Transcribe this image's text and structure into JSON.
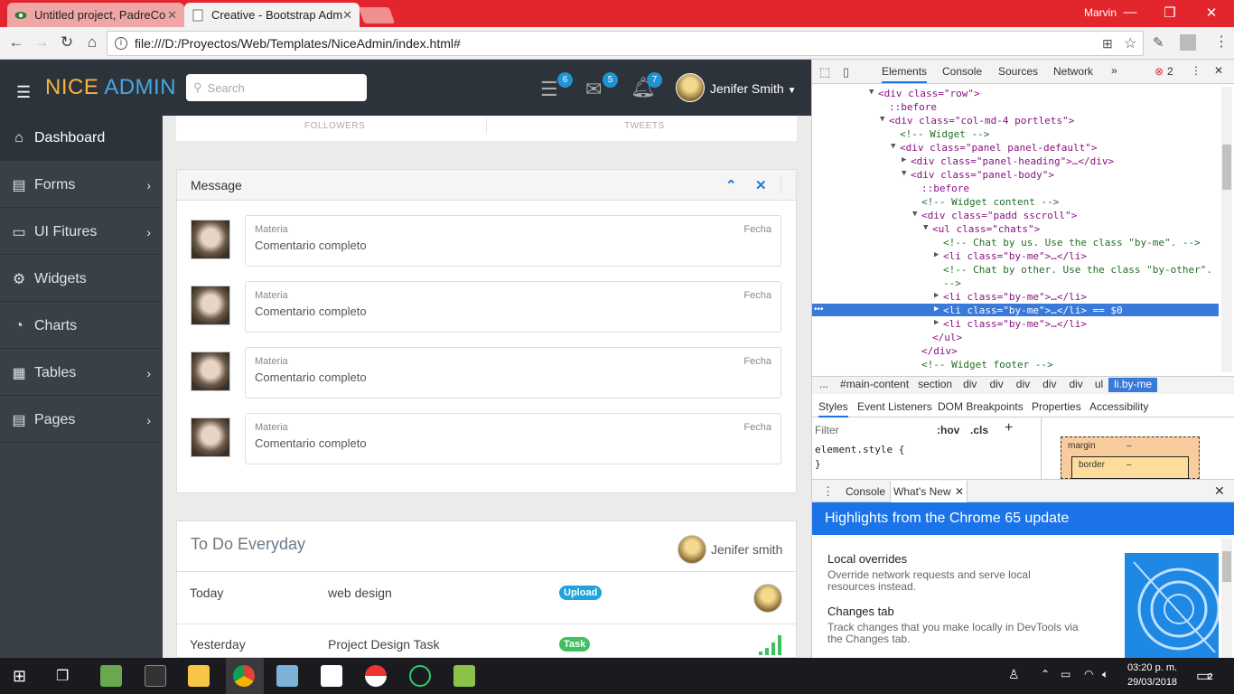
{
  "browser": {
    "tabs": [
      {
        "title": "Untitled project, PadreCo"
      },
      {
        "title": "Creative - Bootstrap Adm"
      }
    ],
    "user": "Marvin",
    "url": "file:///D:/Proyectos/Web/Templates/NiceAdmin/index.html#"
  },
  "app": {
    "logo_part1": "NICE ",
    "logo_part2": "ADMIN",
    "search_placeholder": "Search",
    "badges": {
      "tasks": "6",
      "mail": "5",
      "notifications": "7"
    },
    "user_name": "Jenifer Smith"
  },
  "sidebar": {
    "items": [
      {
        "label": "Dashboard",
        "icon": "home-icon"
      },
      {
        "label": "Forms",
        "icon": "document-icon"
      },
      {
        "label": "UI Fitures",
        "icon": "monitor-icon"
      },
      {
        "label": "Widgets",
        "icon": "cog-icon"
      },
      {
        "label": "Charts",
        "icon": "pie-chart-icon"
      },
      {
        "label": "Tables",
        "icon": "table-icon"
      },
      {
        "label": "Pages",
        "icon": "pages-icon"
      }
    ]
  },
  "stats": {
    "followers": "FOLLOWERS",
    "tweets": "TWEETS"
  },
  "message_panel": {
    "title": "Message",
    "chats": [
      {
        "subject": "Materia",
        "date": "Fecha",
        "body": "Comentario completo"
      },
      {
        "subject": "Materia",
        "date": "Fecha",
        "body": "Comentario completo"
      },
      {
        "subject": "Materia",
        "date": "Fecha",
        "body": "Comentario completo"
      },
      {
        "subject": "Materia",
        "date": "Fecha",
        "body": "Comentario completo"
      }
    ]
  },
  "todo_panel": {
    "title": "To Do Everyday",
    "user": "Jenifer smith",
    "rows": [
      {
        "day": "Today",
        "task": "web design",
        "tag": "Upload",
        "tag_color": "#1fa3dc"
      },
      {
        "day": "Yesterday",
        "task": "Project Design Task",
        "tag": "Task",
        "tag_color": "#3cc15d"
      }
    ]
  },
  "devtools": {
    "tabs": [
      "Elements",
      "Console",
      "Sources",
      "Network"
    ],
    "error_count": "2",
    "breadcrumbs": [
      "...",
      "#main-content",
      "section",
      "div",
      "div",
      "div",
      "div",
      "div",
      "ul",
      "li.by-me"
    ],
    "style_tabs": [
      "Styles",
      "Event Listeners",
      "DOM Breakpoints",
      "Properties",
      "Accessibility"
    ],
    "filter_placeholder": "Filter",
    "hov": ":hov",
    "cls": ".cls",
    "element_style": "element.style {",
    "element_style_close": "}",
    "box_margin": "margin",
    "box_border": "border",
    "box_dash": "–",
    "drawer_tabs": [
      "Console",
      "What's New"
    ],
    "whatsnew_title": "Highlights from the Chrome 65 update",
    "features": [
      {
        "title": "Local overrides",
        "desc": "Override network requests and serve local resources instead."
      },
      {
        "title": "Changes tab",
        "desc": "Track changes that you make locally in DevTools via the Changes tab."
      }
    ],
    "dom_lines": [
      {
        "indent": 0,
        "text": "<div class=\"row\">"
      },
      {
        "indent": 1,
        "text": "::before"
      },
      {
        "indent": 1,
        "text": "<div class=\"col-md-4 portlets\">"
      },
      {
        "indent": 2,
        "text": "<!-- Widget -->"
      },
      {
        "indent": 2,
        "text": "<div class=\"panel panel-default\">"
      },
      {
        "indent": 3,
        "text": "<div class=\"panel-heading\">…</div>"
      },
      {
        "indent": 3,
        "text": "<div class=\"panel-body\">"
      },
      {
        "indent": 4,
        "text": "::before"
      },
      {
        "indent": 4,
        "text": "<!-- Widget content -->"
      },
      {
        "indent": 4,
        "text": "<div class=\"padd sscroll\">"
      },
      {
        "indent": 5,
        "text": "<ul class=\"chats\">"
      },
      {
        "indent": 6,
        "text": "<!-- Chat by us. Use the class \"by-me\". -->"
      },
      {
        "indent": 6,
        "text": "<li class=\"by-me\">…</li>"
      },
      {
        "indent": 6,
        "text": "<!-- Chat by other. Use the class \"by-other\"."
      },
      {
        "indent": 6,
        "text": "-->"
      },
      {
        "indent": 6,
        "text": "<li class=\"by-me\">…</li>"
      },
      {
        "indent": 6,
        "text": "<li class=\"by-me\">…</li> == $0"
      },
      {
        "indent": 6,
        "text": "<li class=\"by-me\">…</li>"
      },
      {
        "indent": 5,
        "text": "</ul>"
      },
      {
        "indent": 4,
        "text": "</div>"
      },
      {
        "indent": 4,
        "text": "<!-- Widget footer -->"
      }
    ]
  },
  "taskbar": {
    "time": "03:20 p. m.",
    "date": "29/03/2018",
    "notification_count": "2"
  },
  "colors": {
    "chrome_red": "#e3262e",
    "sidebar": "#394047",
    "header": "#2c333a",
    "accent": "#1f93d4",
    "logo_orange": "#f5b53e"
  }
}
